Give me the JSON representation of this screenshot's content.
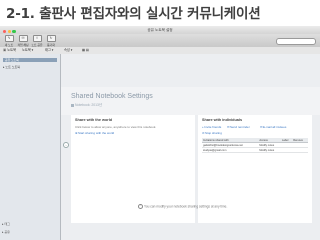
{
  "heading": "2-1. 출판사 편집자와의 실시간 커뮤니케이션",
  "window": {
    "title": "공유 노트북 설정",
    "traffic_lights": [
      "#fc605c",
      "#fdbc40",
      "#34c84a"
    ]
  },
  "toolbar": {
    "items": [
      {
        "icon": "note-icon",
        "glyph": "✎",
        "label": "새 노트"
      },
      {
        "icon": "chat-icon",
        "glyph": "✉",
        "label": "작업 채팅"
      },
      {
        "icon": "share-icon",
        "glyph": "⇪",
        "label": "노트 공유"
      },
      {
        "icon": "sync-icon",
        "glyph": "↻",
        "label": "동기화"
      }
    ]
  },
  "tabbar": {
    "items": [
      {
        "icon": "notebook-icon",
        "glyph": "▣",
        "label": "노트북"
      },
      {
        "icon": "dropdown-icon",
        "glyph": "",
        "label": "노트북 ▾"
      },
      {
        "icon": "tag-icon",
        "glyph": "",
        "label": "태그 ▾"
      },
      {
        "icon": "attribute-icon",
        "glyph": "",
        "label": "속성 ▾"
      },
      {
        "icon": "grid-icon",
        "glyph": "",
        "label": "▦ ▤"
      }
    ]
  },
  "sidebar": {
    "selected_label": "공유 노트북",
    "items": [
      "▸ 노트 노트북"
    ],
    "footer_items": [
      "▸ 태그",
      "▸ 공유"
    ]
  },
  "note": {
    "title": "Shared Notebook Settings",
    "subtitle": "Notebook: 2013년"
  },
  "left_panel": {
    "heading": "Share with the world",
    "description": "Click below to allow anyone, anywhere to view this notebook.",
    "link": "Start sharing with the world"
  },
  "right_panel": {
    "heading": "Share with individuals",
    "links": [
      "Invite friends",
      "Send reminder",
      "E-mail all invitees",
      "Stop sharing"
    ],
    "table": {
      "headers": [
        "Invitations shared with",
        "Access",
        "Label",
        "Remove"
      ],
      "rows": [
        [
          "galsisfirst@bookdesignerkorea.net",
          "Modify notes",
          "",
          ""
        ],
        [
          "studyas@gmail.com",
          "Modify notes",
          "",
          ""
        ]
      ]
    }
  },
  "footer": {
    "text": "You can modify your notebook sharing settings at any time."
  }
}
